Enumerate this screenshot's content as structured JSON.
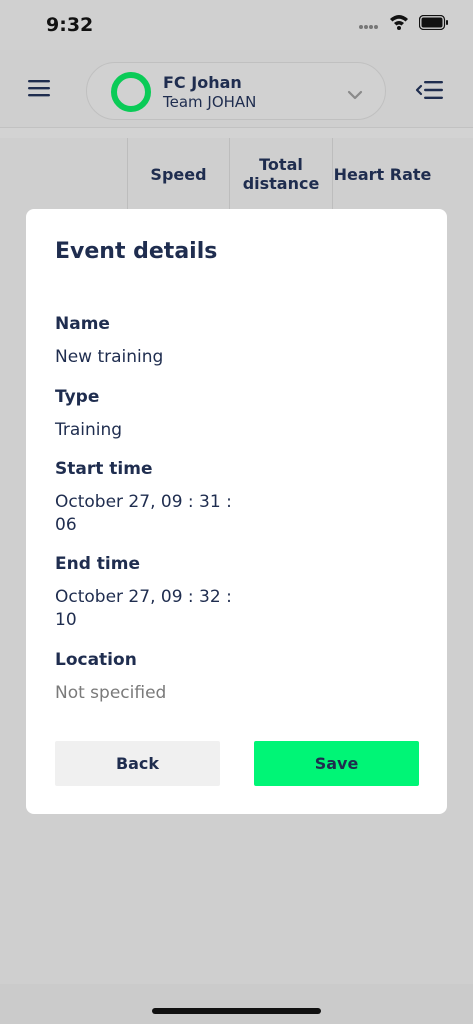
{
  "status_bar": {
    "time": "9:32"
  },
  "header": {
    "team_name": "FC Johan",
    "team_subtitle": "Team JOHAN",
    "accent_color": "#0acb57"
  },
  "table": {
    "columns": [
      "Speed",
      "Total distance",
      "Heart Rate"
    ]
  },
  "modal": {
    "title": "Event details",
    "fields": [
      {
        "label": "Name",
        "value": "New training"
      },
      {
        "label": "Type",
        "value": "Training"
      },
      {
        "label": "Start time",
        "value": "October 27, 09 : 31 : 06"
      },
      {
        "label": "End time",
        "value": "October 27, 09 : 32 : 10"
      },
      {
        "label": "Location",
        "value": "Not specified"
      }
    ],
    "back_label": "Back",
    "save_label": "Save",
    "save_color": "#00f576"
  }
}
